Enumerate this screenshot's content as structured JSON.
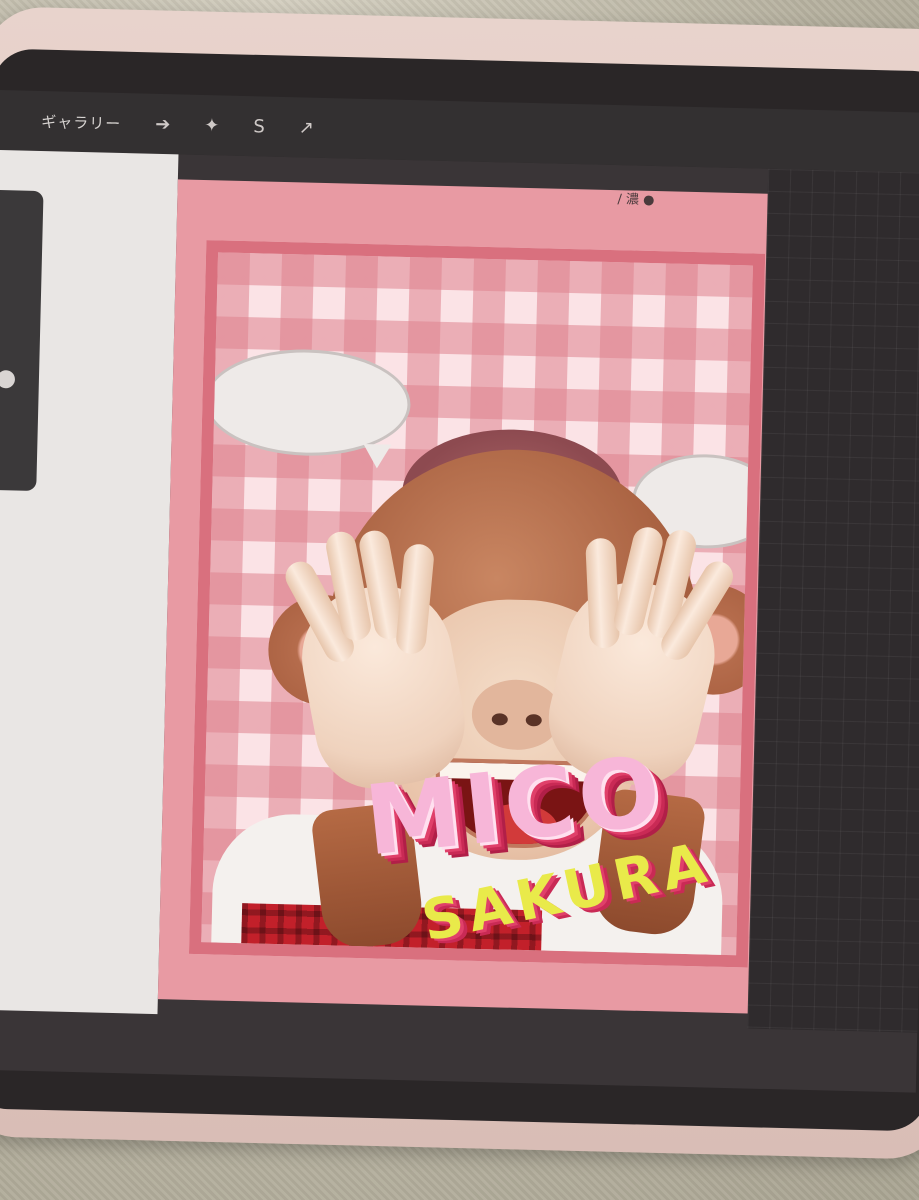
{
  "toolbar": {
    "gallery_label": "ギャラリー",
    "tools": [
      {
        "icon": "wrench-icon",
        "glyph": "➔"
      },
      {
        "icon": "adjustments-icon",
        "glyph": "✦"
      },
      {
        "icon": "selection-icon",
        "glyph": "S"
      },
      {
        "icon": "transform-icon",
        "glyph": "↗"
      }
    ]
  },
  "canvas_status": "/ 濃 ●",
  "artwork": {
    "title_line1": "MICO",
    "title_line2": "SAKURA"
  },
  "colors": {
    "canvas_bg": "#e89aa3",
    "frame_border": "#d9707e",
    "mico_fill": "#f7b6d8",
    "sakura_fill": "#e9ea4a",
    "toolbar_bg": "#333031"
  }
}
